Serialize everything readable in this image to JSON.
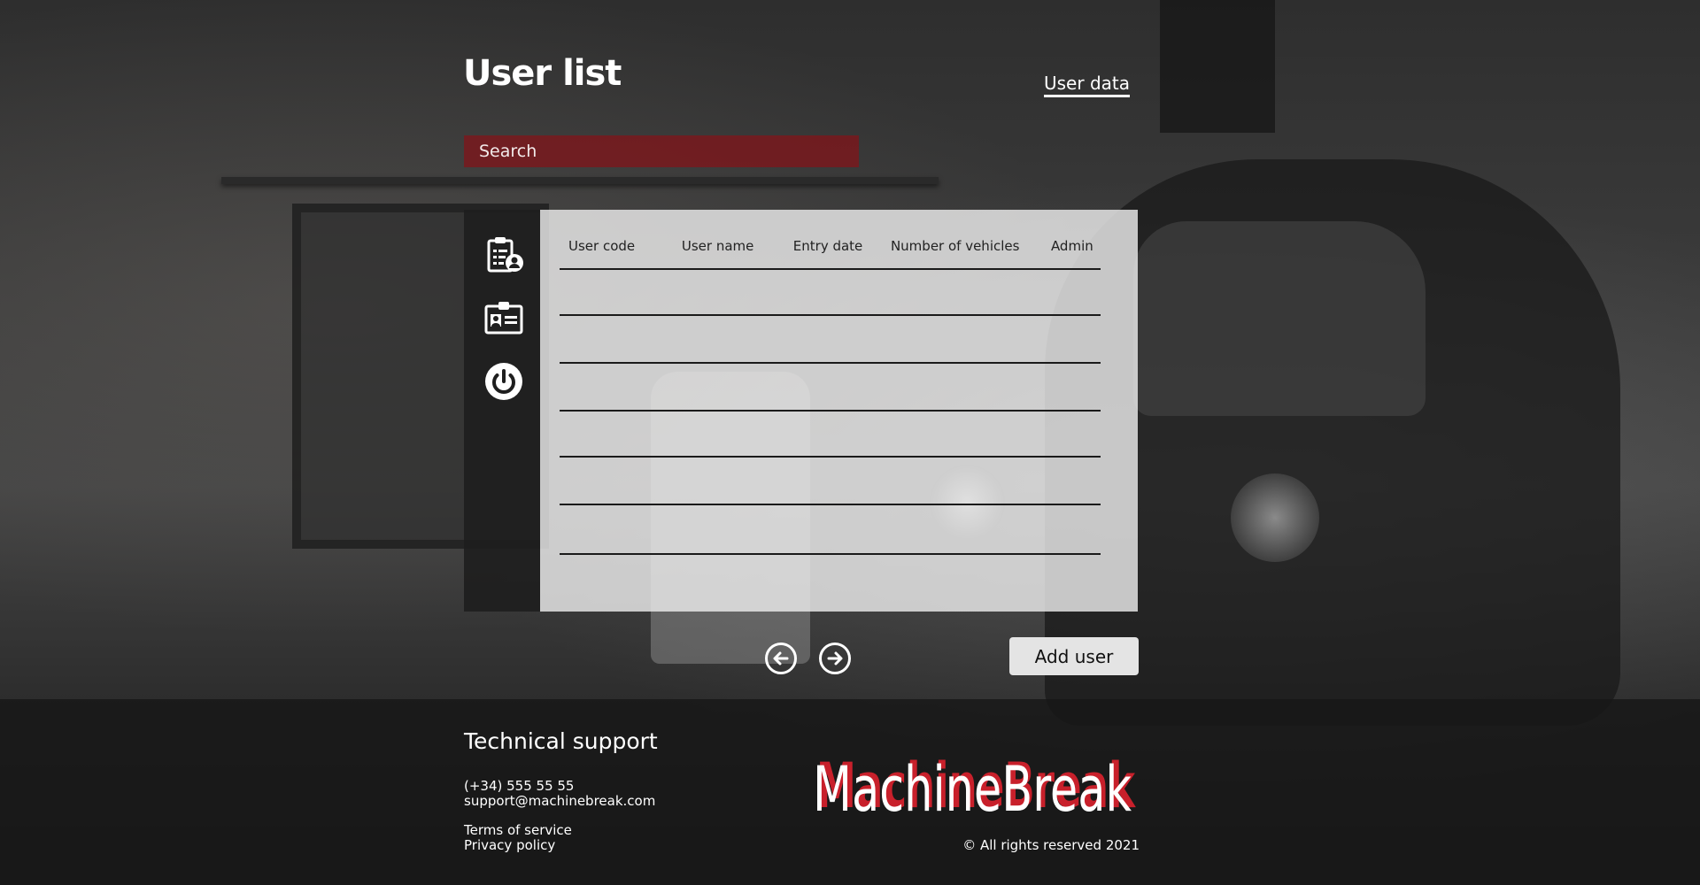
{
  "header": {
    "title": "User list",
    "user_data_link": "User data"
  },
  "search": {
    "placeholder": "Search"
  },
  "sidebar": {
    "icons": [
      "user-list-icon",
      "id-card-icon",
      "power-icon"
    ]
  },
  "table": {
    "columns": [
      "User code",
      "User name",
      "Entry date",
      "Number of vehicles",
      "Admin"
    ],
    "rows": []
  },
  "pagination": {
    "prev_icon": "arrow-left-circle-icon",
    "next_icon": "arrow-right-circle-icon"
  },
  "actions": {
    "add_user_label": "Add user"
  },
  "footer": {
    "support_title": "Technical support",
    "phone": "(+34) 555 55 55",
    "email": "support@machinebreak.com",
    "terms": "Terms of service",
    "privacy": "Privacy policy",
    "logo_text": "MachineBreak",
    "rights": "© All rights reserved 2021"
  },
  "colors": {
    "search_bg": "#821419",
    "logo_shadow": "#c8202b",
    "panel_bg": "#ebebeb",
    "sidebar_bg": "#1e1e1e"
  }
}
